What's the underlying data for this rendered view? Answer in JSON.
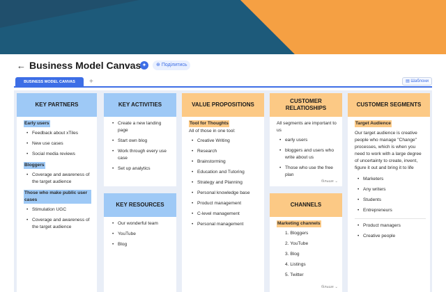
{
  "header": {
    "back_icon": "arrow-left-icon",
    "title": "Business Model Canvas",
    "more": "···",
    "avatar_initial": "✦",
    "share_label": "Поділитись",
    "templates_label": "Шаблони"
  },
  "tabs": [
    {
      "label": "BUSINESS MODEL CANVAS"
    }
  ],
  "add_tab": "+",
  "colors": {
    "accent": "#3d6ee6",
    "blue_card": "#9ec9f6",
    "orange_card": "#fcc985",
    "board": "#e9eef7",
    "banner_dark": "#1d5a7a",
    "banner_orange": "#f28a3a"
  },
  "columns": {
    "key_partners": {
      "title": "KEY PARTNERS",
      "sections": [
        {
          "heading": "Early users",
          "items": [
            "Feedback about xTiles",
            "New use cases",
            "Social media reviews"
          ]
        },
        {
          "heading": "Bloggers",
          "items": [
            "Coverage and awareness of the target audience"
          ]
        },
        {
          "heading": "Those who make public user cases",
          "items": [
            "Stimulation UGC",
            "Coverage and awareness of the target audience"
          ]
        }
      ]
    },
    "key_activities": {
      "title": "KEY ACTIVITIES",
      "items": [
        "Create a new landing page",
        "Start own blog",
        "Work through every use case",
        "Set up analytics"
      ]
    },
    "key_resources": {
      "title": "KEY RESOURCES",
      "items": [
        "Our wonderful team",
        "YouTube",
        "Blog"
      ]
    },
    "value_propositions": {
      "title": "VALUE PROPOSITIONS",
      "heading": "Tool for Thoughts",
      "intro": "All of those in one tool:",
      "items": [
        "Creative Writing",
        "Research",
        "Brainstorming",
        "Education and Tutoring",
        "Strategy and Planning",
        "Personal knowledge base",
        "Product management",
        "C-level management",
        "Personal management"
      ]
    },
    "customer_relationships": {
      "title": "CUSTOMER RELATIOSHIPS",
      "intro": "All segments are important to us",
      "items": [
        "early users",
        "bloggers and users who write about us",
        "Those who use the free plan"
      ],
      "more": "більше ⌄"
    },
    "channels": {
      "title": "CHANNELS",
      "heading": "Marketing channels",
      "items": [
        "1.  Bloggers",
        "2.  YouTube",
        "3.  Blog",
        "4.  Listings",
        "5.  Twitter"
      ],
      "more": "більше ⌄"
    },
    "customer_segments": {
      "title": "CUSTOMER SEGMENTS",
      "heading": "Target Audience",
      "intro": "Our target audience is creative people who manage \"Change\" processes, which is when you need to work with a large degree of uncertainty to create, invent, figure it out and bring it to life",
      "items": [
        "Marketers",
        "Any writers",
        "Students",
        "Entrepreneurs"
      ],
      "items2": [
        "Product managers",
        "Creative people"
      ]
    }
  }
}
